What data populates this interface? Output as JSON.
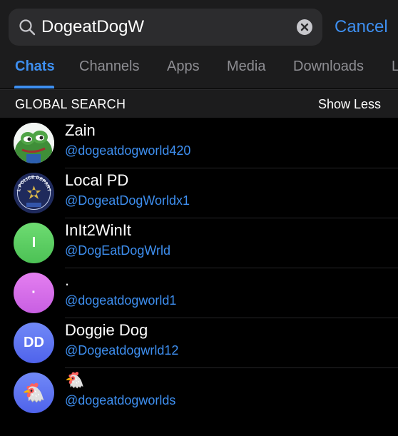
{
  "search": {
    "query": "DogeatDogW",
    "cancel_label": "Cancel"
  },
  "tabs": [
    {
      "label": "Chats",
      "active": true
    },
    {
      "label": "Channels",
      "active": false
    },
    {
      "label": "Apps",
      "active": false
    },
    {
      "label": "Media",
      "active": false
    },
    {
      "label": "Downloads",
      "active": false
    },
    {
      "label": "L",
      "active": false
    }
  ],
  "section": {
    "title": "GLOBAL SEARCH",
    "action_label": "Show Less"
  },
  "results": [
    {
      "name": "Zain",
      "handle": "@dogeatdogworld420",
      "avatar": {
        "type": "image",
        "icon": "frog-icon"
      }
    },
    {
      "name": "Local PD",
      "handle": "@DogeatDogWorldx1",
      "avatar": {
        "type": "image",
        "icon": "police-badge-icon",
        "text": "LOCAL POLICE DEPARTMENT"
      }
    },
    {
      "name": "InIt2WinIt",
      "handle": "@DogEatDogWrld",
      "avatar": {
        "type": "initials",
        "text": "I",
        "color": "#5ccf62"
      }
    },
    {
      "name": ".",
      "handle": "@dogeatdogworld1",
      "avatar": {
        "type": "initials",
        "text": "·",
        "color": "#d76de8"
      }
    },
    {
      "name": "Doggie Dog",
      "handle": "@Dogeatdogwrld12",
      "avatar": {
        "type": "initials",
        "text": "DD",
        "color": "#5b6ef0"
      }
    },
    {
      "name": "🐔",
      "handle": "@dogeatdogworlds",
      "avatar": {
        "type": "emoji",
        "text": "🐔",
        "color": "#5b6ef0"
      }
    }
  ],
  "colors": {
    "accent": "#3e8ff0",
    "background": "#000000",
    "header": "#1c1c1d"
  }
}
